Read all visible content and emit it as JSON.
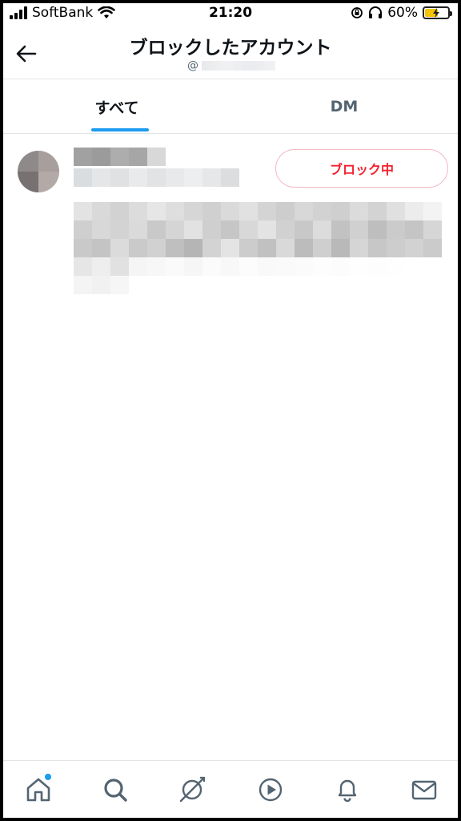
{
  "status_bar": {
    "carrier": "SoftBank",
    "time": "21:20",
    "battery": "60%",
    "battery_level": 0.6,
    "icons": [
      "signal-icon",
      "wifi-icon",
      "orientation-lock-icon",
      "headphones-icon",
      "battery-charging-icon"
    ]
  },
  "header": {
    "title": "ブロックしたアカウント",
    "handle_prefix": "@"
  },
  "tabs": [
    {
      "label": "すべて",
      "selected": true
    },
    {
      "label": "DM",
      "selected": false
    }
  ],
  "account": {
    "block_label": "ブロック中"
  },
  "colors": {
    "accent": "#1d9bf0",
    "block_red": "#f4212e",
    "block_border": "#f4b8c2"
  },
  "bottom_nav": {
    "items": [
      "home-icon",
      "search-icon",
      "spaces-icon",
      "video-icon",
      "notifications-icon",
      "messages-icon"
    ]
  }
}
